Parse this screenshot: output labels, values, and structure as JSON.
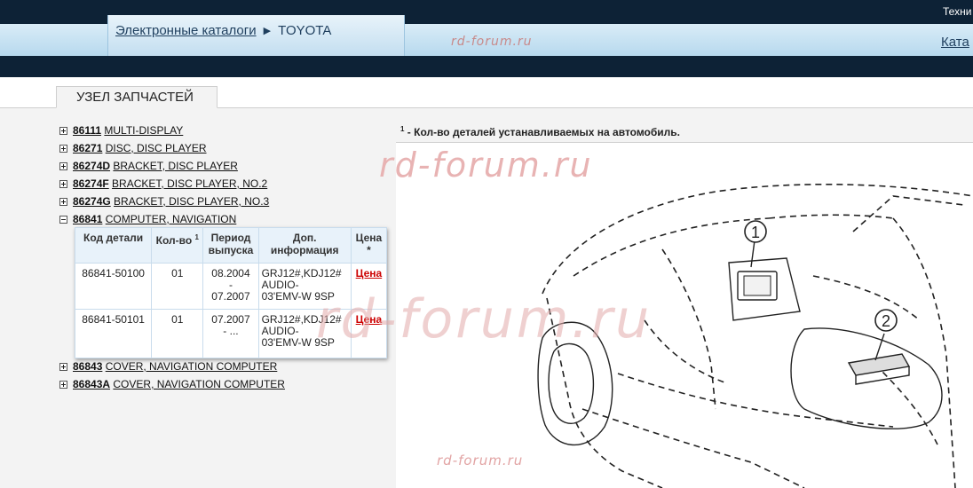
{
  "header": {
    "top_right_link": "Техни",
    "breadcrumb_catalogs": "Электронные каталоги",
    "breadcrumb_separator": "▶",
    "breadcrumb_current": "TOYOTA",
    "right_link": "Ката",
    "watermark_small": "rd-forum.ru"
  },
  "section": {
    "tab_label": "УЗЕЛ ЗАПЧАСТЕЙ"
  },
  "tree": {
    "items": [
      {
        "code": "86111",
        "name": "MULTI-DISPLAY",
        "expanded": false
      },
      {
        "code": "86271",
        "name": "DISC, DISC PLAYER",
        "expanded": false
      },
      {
        "code": "86274D",
        "name": "BRACKET, DISC PLAYER",
        "expanded": false
      },
      {
        "code": "86274F",
        "name": "BRACKET, DISC PLAYER, NO.2",
        "expanded": false
      },
      {
        "code": "86274G",
        "name": "BRACKET, DISC PLAYER, NO.3",
        "expanded": false
      },
      {
        "code": "86841",
        "name": "COMPUTER, NAVIGATION",
        "expanded": true
      },
      {
        "code": "86843",
        "name": "COVER, NAVIGATION COMPUTER",
        "expanded": false
      },
      {
        "code": "86843A",
        "name": "COVER, NAVIGATION COMPUTER",
        "expanded": false
      }
    ]
  },
  "parts_table": {
    "headers": {
      "code": "Код детали",
      "qty": "Кол-во",
      "qty_sup": "1",
      "period_line1": "Период",
      "period_line2": "выпуска",
      "info_line1": "Доп.",
      "info_line2": "информация",
      "price": "Цена",
      "price_sup": "*"
    },
    "rows": [
      {
        "code": "86841-50100",
        "qty": "01",
        "period_line1": "08.2004",
        "period_line2": "-",
        "period_line3": "07.2007",
        "info_line1": "GRJ12#,KDJ12#",
        "info_line2": "AUDIO-",
        "info_line3": "03'EMV-W 9SP",
        "price": "Цена"
      },
      {
        "code": "86841-50101",
        "qty": "01",
        "period_line1": "07.2007",
        "period_line2": "- ...",
        "period_line3": "",
        "info_line1": "GRJ12#,KDJ12#",
        "info_line2": "AUDIO-",
        "info_line3": "03'EMV-W 9SP",
        "price": "Цена"
      }
    ]
  },
  "note": {
    "sup": "1",
    "text": " - Кол-во деталей устанавливаемых на автомобиль."
  },
  "diagram": {
    "callout_1": "1",
    "callout_2": "2"
  },
  "watermarks": {
    "mid": "rd-forum.ru",
    "big": "rd-forum.ru",
    "bottom": "rd-forum.ru"
  },
  "colors": {
    "header_dark": "#0d2236",
    "header_blue": "#c3def0",
    "price_red": "#cc0000",
    "table_border": "#9ec6e6"
  }
}
